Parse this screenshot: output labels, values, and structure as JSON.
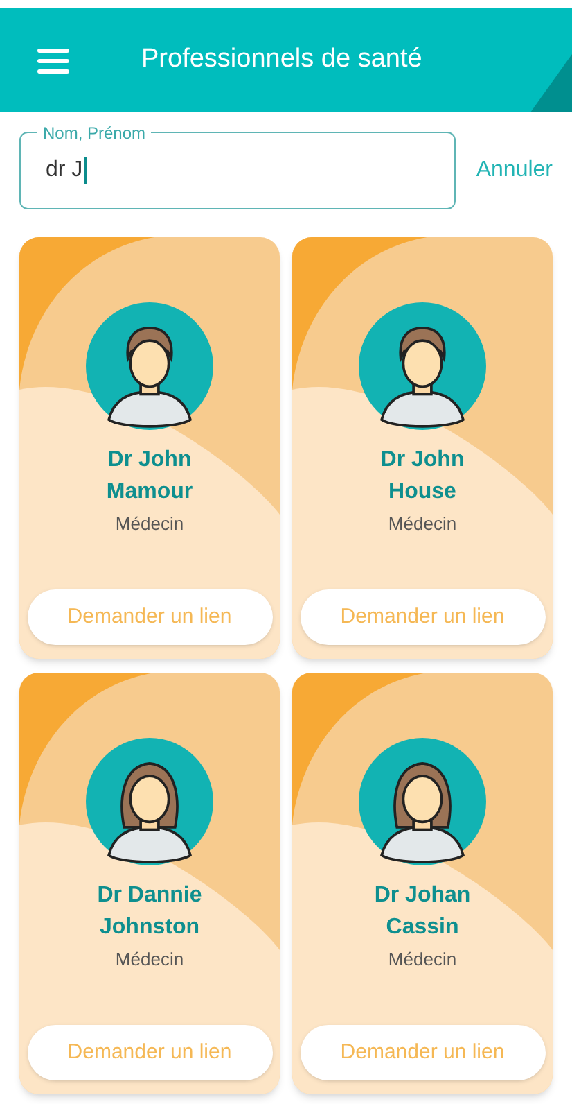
{
  "header": {
    "title": "Professionnels de santé"
  },
  "search": {
    "label": "Nom, Prénom",
    "value": "dr J",
    "cancel": "Annuler"
  },
  "professionals": [
    {
      "name": "Dr John Mamour",
      "role": "Médecin",
      "kind": "male",
      "action": "Demander un lien"
    },
    {
      "name": "Dr John House",
      "role": "Médecin",
      "kind": "male",
      "action": "Demander un lien"
    },
    {
      "name": "Dr Dannie Johnston",
      "role": "Médecin",
      "kind": "female",
      "action": "Demander un lien"
    },
    {
      "name": "Dr Johan Cassin",
      "role": "Médecin",
      "kind": "female",
      "action": "Demander un lien"
    }
  ]
}
